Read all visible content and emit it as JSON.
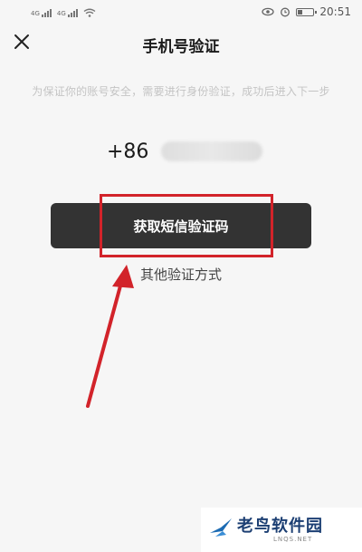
{
  "status_bar": {
    "time": "20:51",
    "signal_label_1": "4G",
    "signal_label_2": "4G",
    "battery_level": 0.3
  },
  "header": {
    "title": "手机号验证"
  },
  "hint": "为保证你的账号安全，需要进行身份验证，成功后进入下一步",
  "phone": {
    "prefix": "+86"
  },
  "primary_button": {
    "label": "获取短信验证码"
  },
  "secondary_link": {
    "label": "其他验证方式"
  },
  "annotation": {
    "color": "#d2232a"
  },
  "watermark": {
    "name": "老鸟软件园",
    "domain": "LNQS.NET"
  }
}
